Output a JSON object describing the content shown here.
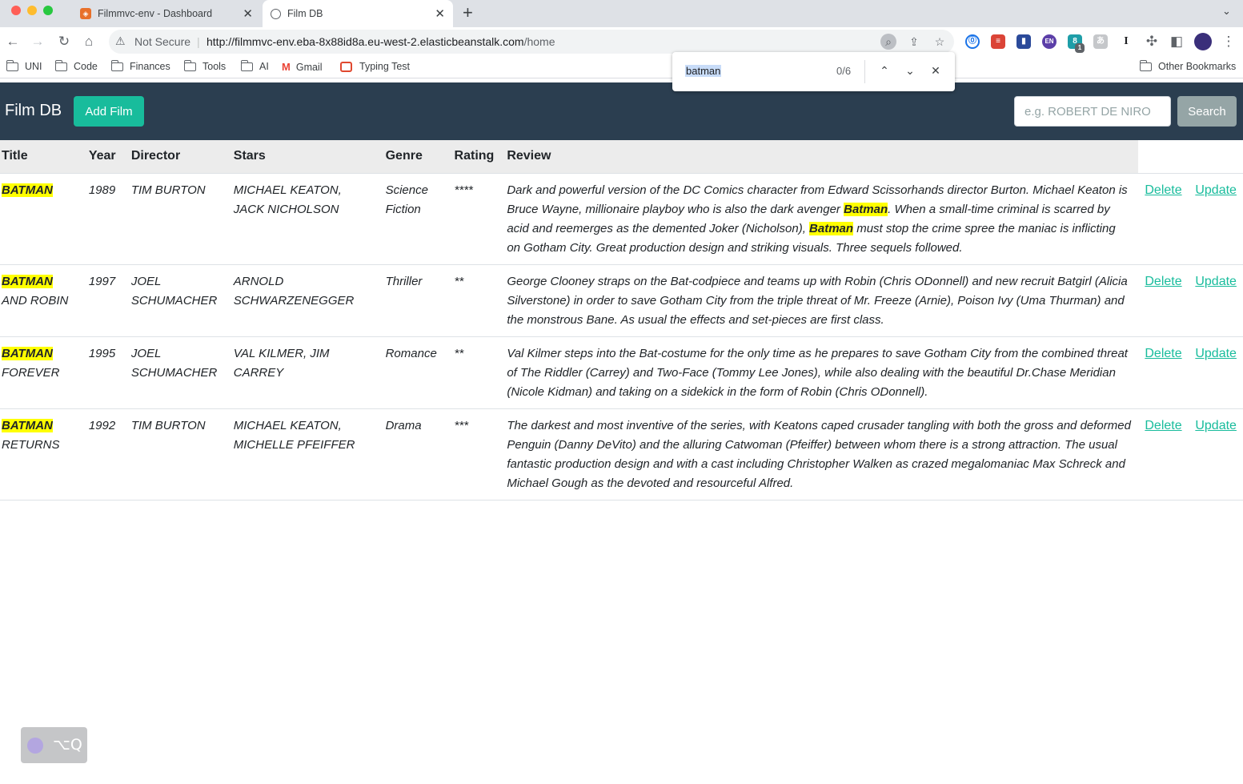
{
  "browser": {
    "tabs": [
      {
        "title": "Filmmvc-env - Dashboard",
        "active": false
      },
      {
        "title": "Film DB",
        "active": true
      }
    ],
    "address": {
      "security_label": "Not Secure",
      "url_host": "http://filmmvc-env.eba-8x88id8a.eu-west-2.elasticbeanstalk.com",
      "url_path": "/home"
    },
    "bookmarks": [
      "UNI",
      "Code",
      "Finances",
      "Tools",
      "AI",
      "Gmail",
      "Typing Test"
    ],
    "other_bookmarks": "Other Bookmarks",
    "find": {
      "query": "batman",
      "count": "0/6"
    },
    "extension_badge": "1"
  },
  "navbar": {
    "brand": "Film DB",
    "add_film": "Add Film",
    "search_placeholder": "e.g. ROBERT DE NIRO",
    "search_button": "Search"
  },
  "table": {
    "headers": [
      "Title",
      "Year",
      "Director",
      "Stars",
      "Genre",
      "Rating",
      "Review"
    ],
    "delete_label": "Delete",
    "update_label": "Update",
    "rows": [
      {
        "title_hl": "BATMAN",
        "title_rest": "",
        "year": "1989",
        "director": "TIM BURTON",
        "stars": "MICHAEL KEATON, JACK NICHOLSON",
        "genre": "Science Fiction",
        "rating": "****",
        "review": [
          {
            "t": "Dark and powerful version of the DC Comics character from Edward Scissorhands director Burton. Michael Keaton is Bruce Wayne, millionaire playboy who is also the dark avenger ",
            "hl": false
          },
          {
            "t": "Batman",
            "hl": true
          },
          {
            "t": ". When a small-time criminal is scarred by acid and reemerges as the demented Joker (Nicholson), ",
            "hl": false
          },
          {
            "t": "Batman",
            "hl": true
          },
          {
            "t": " must stop the crime spree the maniac is inflicting on Gotham City. Great production design and striking visuals. Three sequels followed.",
            "hl": false
          }
        ]
      },
      {
        "title_hl": "BATMAN",
        "title_rest": " AND ROBIN",
        "year": "1997",
        "director": "JOEL SCHUMACHER",
        "stars": "ARNOLD SCHWARZENEGGER",
        "genre": "Thriller",
        "rating": "**",
        "review": [
          {
            "t": "George Clooney straps on the Bat-codpiece and teams up with Robin (Chris ODonnell) and new recruit Batgirl (Alicia Silverstone) in order to save Gotham City from the triple threat of Mr. Freeze (Arnie), Poison Ivy (Uma Thurman) and the monstrous Bane. As usual the effects and set-pieces are first class.",
            "hl": false
          }
        ]
      },
      {
        "title_hl": "BATMAN",
        "title_rest": " FOREVER",
        "year": "1995",
        "director": "JOEL SCHUMACHER",
        "stars": "VAL KILMER, JIM CARREY",
        "genre": "Romance",
        "rating": "**",
        "review": [
          {
            "t": "Val Kilmer steps into the Bat-costume for the only time as he prepares to save Gotham City from the combined threat of The Riddler (Carrey) and Two-Face (Tommy Lee Jones), while also dealing with the beautiful Dr.Chase Meridian (Nicole Kidman) and taking on a sidekick in the form of Robin (Chris ODonnell).",
            "hl": false
          }
        ]
      },
      {
        "title_hl": "BATMAN",
        "title_rest": " RETURNS",
        "year": "1992",
        "director": "TIM BURTON",
        "stars": "MICHAEL KEATON, MICHELLE PFEIFFER",
        "genre": "Drama",
        "rating": "***",
        "review": [
          {
            "t": "The darkest and most inventive of the series, with Keatons caped crusader tangling with both the gross and deformed Penguin (Danny DeVito) and the alluring Catwoman (Pfeiffer) between whom there is a strong attraction. The usual fantastic production design and with a cast including Christopher Walken as crazed megalomaniac Max Schreck and Michael Gough as the devoted and resourceful Alfred.",
            "hl": false
          }
        ]
      }
    ]
  },
  "widget": {
    "shortcut": "⌥Q"
  },
  "colors": {
    "navbar": "#2b3e50",
    "accent": "#18bc9c",
    "search_button": "#95a5a6",
    "highlight": "#ffff00"
  },
  "icons": [
    "back-icon",
    "forward-icon",
    "reload-icon",
    "home-icon",
    "warning-icon",
    "lens-icon",
    "share-icon",
    "star-icon",
    "puzzle-icon",
    "sidepanel-icon",
    "menu-icon",
    "folder-icon",
    "gmail-icon",
    "typing-test-icon",
    "chevron-up-icon",
    "chevron-down-icon",
    "close-icon"
  ]
}
